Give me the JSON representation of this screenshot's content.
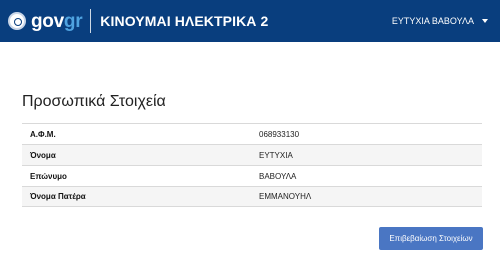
{
  "header": {
    "brand_main": "gov",
    "brand_accent": "gr",
    "app_title": "ΚΙΝΟΥΜΑΙ ΗΛΕΚΤΡΙΚΑ 2",
    "user_name": "ΕΥΤΥΧΙΑ ΒΑΒΟΥΛΑ",
    "colors": {
      "bar": "#093e7e",
      "brand_accent": "#4fa3e0"
    }
  },
  "main": {
    "title": "Προσωπικά Στοιχεία",
    "details": [
      {
        "label": "Α.Φ.Μ.",
        "value": "068933130"
      },
      {
        "label": "Όνομα",
        "value": "ΕΥΤΥΧΙΑ"
      },
      {
        "label": "Επώνυμο",
        "value": "ΒΑΒΟΥΛΑ"
      },
      {
        "label": "Όνομα Πατέρα",
        "value": "ΕΜΜΑΝΟΥΗΛ"
      }
    ],
    "confirm_label": "Επιβεβαίωση Στοιχείων",
    "colors": {
      "button": "#4a76c3"
    }
  }
}
